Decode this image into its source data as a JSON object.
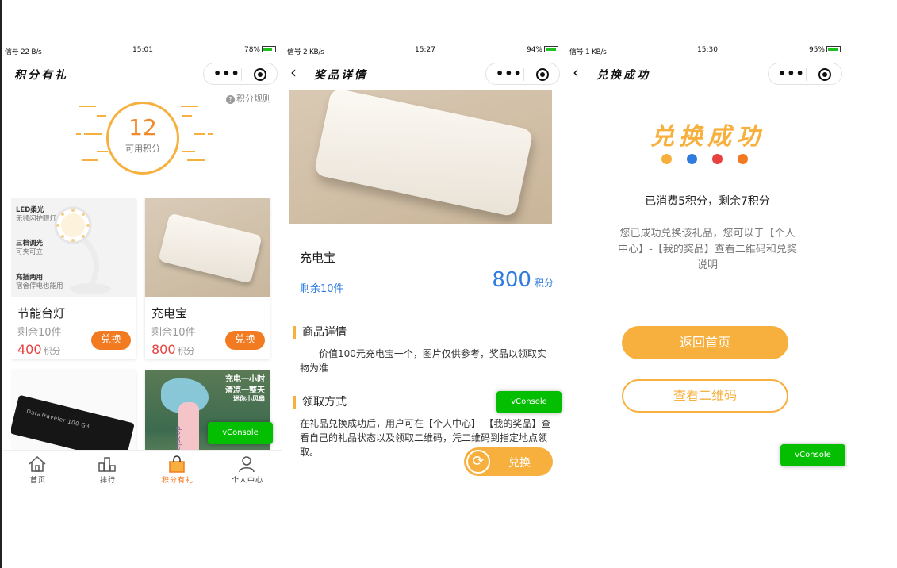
{
  "status_bars": [
    {
      "left": "信号 22 B/s",
      "time": "15:01",
      "right": "78%",
      "battery_level": 0.78
    },
    {
      "left": "信号 2 KB/s",
      "time": "15:27",
      "right": "94%",
      "battery_level": 0.94
    },
    {
      "left": "信号 1 KB/s",
      "time": "15:30",
      "right": "95%",
      "battery_level": 0.95
    }
  ],
  "capsule": {
    "more": "•••"
  },
  "points_page": {
    "title": "积分有礼",
    "rules_link": "积分规则",
    "points_value": "12",
    "points_label": "可用积分",
    "points_unit": "积分",
    "redeem_label": "兑换",
    "gifts": [
      {
        "name": "节能台灯",
        "stock": "剩余10件",
        "price": "400"
      },
      {
        "name": "充电宝",
        "stock": "剩余10件",
        "price": "800"
      }
    ],
    "lamp_texts": [
      "LED柔光",
      "无频闪护眼灯",
      "三档调光",
      "可夹可立",
      "充插两用",
      "宿舍停电也能用"
    ],
    "usb_label": "DataTraveler 100 G3",
    "fan_texts": [
      "充电一小时",
      "清凉一整天",
      "迷你小风扇"
    ],
    "fan_brand": "doodle",
    "vconsole": "vConsole",
    "tabs": [
      {
        "label": "首页",
        "icon": "home-icon"
      },
      {
        "label": "排行",
        "icon": "ranking-icon"
      },
      {
        "label": "积分有礼",
        "icon": "gift-bag-icon"
      },
      {
        "label": "个人中心",
        "icon": "user-icon"
      }
    ],
    "active_tab": 2
  },
  "detail_page": {
    "title": "奖品详情",
    "name": "充电宝",
    "stock": "剩余10件",
    "price": "800",
    "price_unit": "积分",
    "section1_title": "商品详情",
    "section1_body": "　　价值100元充电宝一个，图片仅供参考，奖品以领取实物为准",
    "section2_title": "领取方式",
    "section2_body": "在礼品兑换成功后，用户可在【个人中心】-【我的奖品】查看自己的礼品状态以及领取二维码，凭二维码到指定地点领取。",
    "redeem_label": "兑换",
    "vconsole": "vConsole"
  },
  "success_page": {
    "title": "兑换成功",
    "heading": "兑换成功",
    "dot_colors": [
      "#f7b03e",
      "#2f7be0",
      "#e8413f",
      "#f27b22"
    ],
    "consumed": "已消费5积分，剩余7积分",
    "description": "您已成功兑换该礼品，您可以于【个人中心】-【我的奖品】查看二维码和兑奖说明",
    "back_button": "返回首页",
    "qr_button": "查看二维码",
    "vconsole": "vConsole"
  },
  "colors": {
    "accent_orange": "#f7b03e",
    "redeem_orange": "#f27b22",
    "price_red": "#e8413f",
    "price_blue": "#2f7be0",
    "vconsole_green": "#04be02"
  }
}
